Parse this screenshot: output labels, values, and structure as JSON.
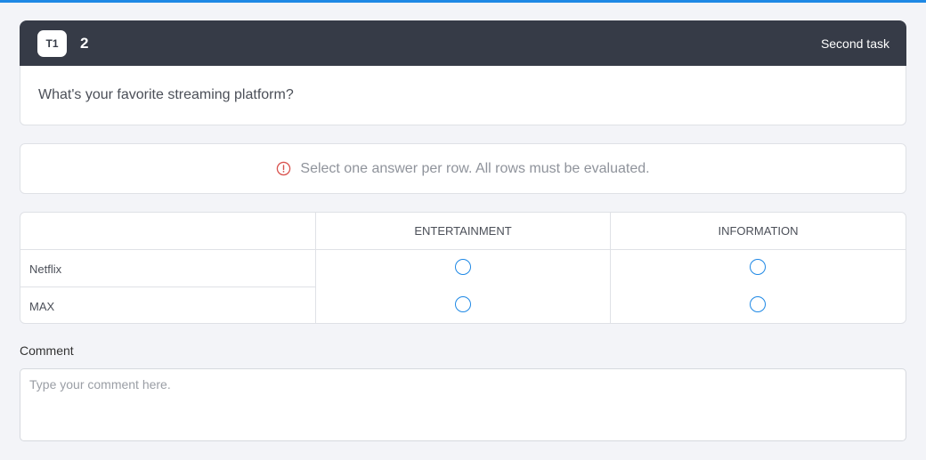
{
  "header": {
    "badge": "T1",
    "number": "2",
    "task_name": "Second task"
  },
  "question": "What's your favorite streaming platform?",
  "notice": {
    "icon": "info-circle-icon",
    "icon_color": "#d9534f",
    "text": "Select one answer per row. All rows must be evaluated."
  },
  "matrix": {
    "columns": [
      "ENTERTAINMENT",
      "INFORMATION"
    ],
    "rows": [
      {
        "label": "Netflix",
        "selected": null
      },
      {
        "label": "MAX",
        "selected": null
      }
    ]
  },
  "comment": {
    "label": "Comment",
    "placeholder": "Type your comment here.",
    "value": ""
  },
  "colors": {
    "accent": "#1e88e5",
    "header_bg": "#363b47",
    "page_bg": "#f3f4f8"
  }
}
